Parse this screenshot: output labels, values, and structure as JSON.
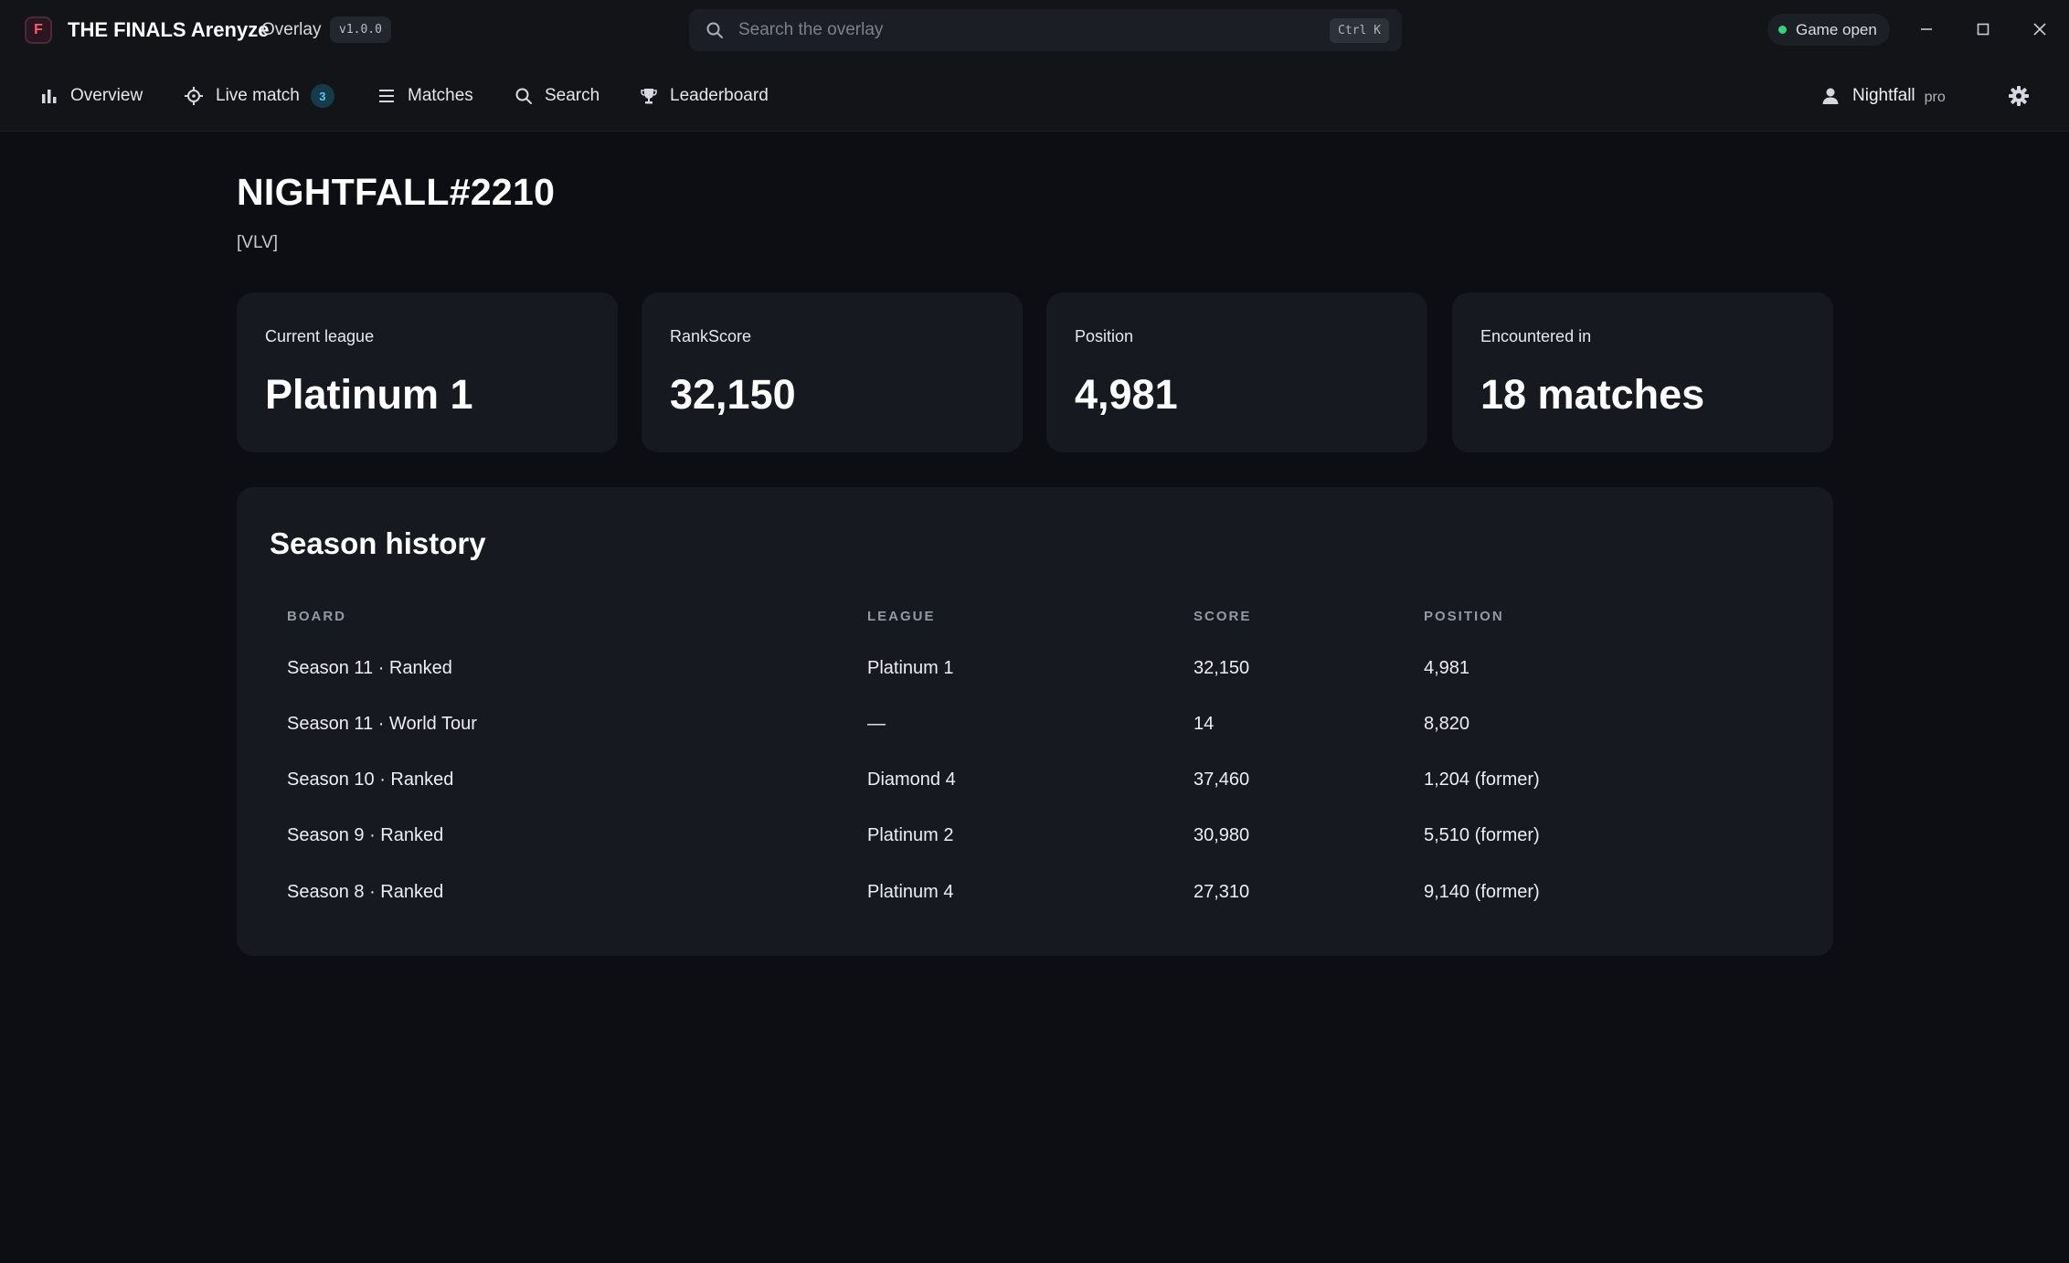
{
  "titlebar": {
    "logo_text": "F",
    "app_name": "THE FINALS Arenyze",
    "app_mode": "Overlay",
    "version": "v1.0.0",
    "search_placeholder": "Search the overlay",
    "search_shortcut": "Ctrl K",
    "status": "Game open"
  },
  "nav": {
    "items": [
      {
        "label": "Overview",
        "icon": "bar-chart-icon"
      },
      {
        "label": "Live match",
        "icon": "crosshair-icon",
        "badge": "3"
      },
      {
        "label": "Matches",
        "icon": "list-icon"
      },
      {
        "label": "Search",
        "icon": "search-icon"
      },
      {
        "label": "Leaderboard",
        "icon": "trophy-icon"
      }
    ],
    "user": {
      "name": "Nightfall",
      "tier": "pro",
      "icon": "user-icon"
    },
    "settings_icon": "gear-icon"
  },
  "player": {
    "name": "NIGHTFALL#2210",
    "club": "[VLV]"
  },
  "stats": [
    {
      "label": "Current league",
      "value": "Platinum 1"
    },
    {
      "label": "RankScore",
      "value": "32,150"
    },
    {
      "label": "Position",
      "value": "4,981"
    },
    {
      "label": "Encountered in",
      "value": "18 matches"
    }
  ],
  "history": {
    "title": "Season history",
    "columns": [
      "BOARD",
      "LEAGUE",
      "SCORE",
      "POSITION"
    ],
    "rows": [
      {
        "board": "Season 11 · Ranked",
        "league": "Platinum 1",
        "score": "32,150",
        "position": "4,981"
      },
      {
        "board": "Season 11 · World Tour",
        "league": "—",
        "score": "14",
        "position": "8,820"
      },
      {
        "board": "Season 10 · Ranked",
        "league": "Diamond 4",
        "score": "37,460",
        "position": "1,204 (former)"
      },
      {
        "board": "Season 9 · Ranked",
        "league": "Platinum 2",
        "score": "30,980",
        "position": "5,510 (former)"
      },
      {
        "board": "Season 8 · Ranked",
        "league": "Platinum 4",
        "score": "27,310",
        "position": "9,140 (former)"
      }
    ]
  },
  "colors": {
    "background": "#0c0e13",
    "bar": "#121418",
    "card": "#161920",
    "status_green": "#34d27b",
    "badge_blue": "#58c8f0",
    "logo_red": "#ff5d6c"
  }
}
